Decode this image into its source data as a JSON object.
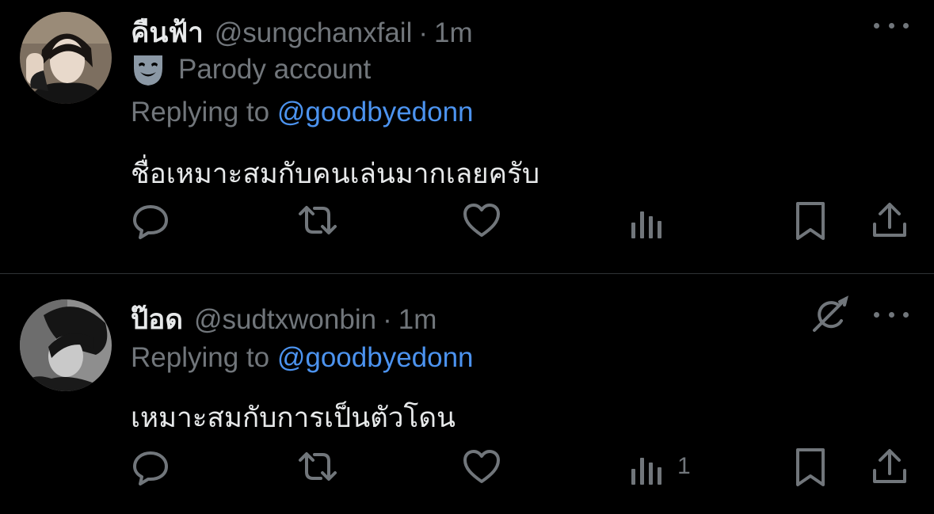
{
  "tweets": [
    {
      "display_name": "คืนฟ้า",
      "handle": "@sungchanxfail",
      "separator": "·",
      "time": "1m",
      "badge": {
        "icon": "theater-mask-icon",
        "label": "Parody account"
      },
      "replying_prefix": "Replying to",
      "replying_handle": "@goodbyedonn",
      "text": "ชื่อเหมาะสมกับคนเล่นมากเลยครับ",
      "views_count": ""
    },
    {
      "display_name": "ป๊อด",
      "handle": "@sudtxwonbin",
      "separator": "·",
      "time": "1m",
      "replying_prefix": "Replying to",
      "replying_handle": "@goodbyedonn",
      "text": "เหมาะสมกับการเป็นตัวโดน",
      "views_count": "1"
    }
  ],
  "colors": {
    "background": "#000000",
    "text": "#e7e9ea",
    "muted": "#71767b",
    "link": "#4c93ef",
    "divider": "#2f3336"
  },
  "icons": [
    "reply-icon",
    "retweet-icon",
    "like-icon",
    "views-icon",
    "bookmark-icon",
    "share-icon",
    "more-icon",
    "grok-icon"
  ]
}
